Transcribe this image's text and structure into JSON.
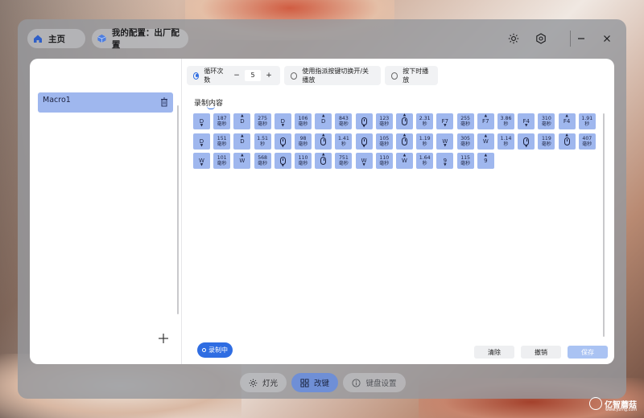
{
  "header": {
    "home_label": "主页",
    "profile_label": "我的配置：出厂配置"
  },
  "options": {
    "loop_label": "循环次数",
    "loop_minus": "−",
    "loop_value": "5",
    "loop_plus": "+",
    "toggle_label": "使用指派按键切换开/关播放",
    "hold_label": "按下时播放",
    "selected": "loop"
  },
  "sidebar": {
    "macros": [
      {
        "label": "Macro1"
      }
    ],
    "add_icon": "plus-icon"
  },
  "recording": {
    "title": "录制内容",
    "rows": [
      [
        {
          "kind": "key",
          "label": "D",
          "dir": "down"
        },
        {
          "kind": "delay",
          "value": "187",
          "unit": "毫秒"
        },
        {
          "kind": "key",
          "label": "D",
          "dir": "up"
        },
        {
          "kind": "delay",
          "value": "275",
          "unit": "毫秒"
        },
        {
          "kind": "key",
          "label": "D",
          "dir": "down"
        },
        {
          "kind": "delay",
          "value": "106",
          "unit": "毫秒"
        },
        {
          "kind": "key",
          "label": "D",
          "dir": "up"
        },
        {
          "kind": "delay",
          "value": "843",
          "unit": "毫秒"
        },
        {
          "kind": "mouse",
          "dir": "down"
        },
        {
          "kind": "delay",
          "value": "123",
          "unit": "毫秒"
        },
        {
          "kind": "mouse",
          "dir": "up"
        },
        {
          "kind": "delay",
          "value": "2.31",
          "unit": "秒"
        },
        {
          "kind": "key",
          "label": "F7",
          "dir": "down"
        },
        {
          "kind": "delay",
          "value": "255",
          "unit": "毫秒"
        },
        {
          "kind": "key",
          "label": "F7",
          "dir": "up"
        },
        {
          "kind": "delay",
          "value": "3.86",
          "unit": "秒"
        },
        {
          "kind": "key",
          "label": "F4",
          "dir": "down"
        },
        {
          "kind": "delay",
          "value": "310",
          "unit": "毫秒"
        },
        {
          "kind": "key",
          "label": "F4",
          "dir": "up"
        },
        {
          "kind": "delay",
          "value": "1.91",
          "unit": "秒"
        }
      ],
      [
        {
          "kind": "key",
          "label": "D",
          "dir": "down"
        },
        {
          "kind": "delay",
          "value": "151",
          "unit": "毫秒"
        },
        {
          "kind": "key",
          "label": "D",
          "dir": "up"
        },
        {
          "kind": "delay",
          "value": "1.51",
          "unit": "秒"
        },
        {
          "kind": "mouse",
          "dir": "down"
        },
        {
          "kind": "delay",
          "value": "98",
          "unit": "毫秒"
        },
        {
          "kind": "mouse",
          "dir": "up"
        },
        {
          "kind": "delay",
          "value": "1.41",
          "unit": "秒"
        },
        {
          "kind": "mouse",
          "dir": "down"
        },
        {
          "kind": "delay",
          "value": "105",
          "unit": "毫秒"
        },
        {
          "kind": "mouse",
          "dir": "up"
        },
        {
          "kind": "delay",
          "value": "1.19",
          "unit": "秒"
        },
        {
          "kind": "key",
          "label": "W",
          "dir": "down"
        },
        {
          "kind": "delay",
          "value": "305",
          "unit": "毫秒"
        },
        {
          "kind": "key",
          "label": "W",
          "dir": "up"
        },
        {
          "kind": "delay",
          "value": "1.14",
          "unit": "秒"
        },
        {
          "kind": "mouse",
          "dir": "down"
        },
        {
          "kind": "delay",
          "value": "119",
          "unit": "毫秒"
        },
        {
          "kind": "mouse",
          "dir": "up"
        },
        {
          "kind": "delay",
          "value": "407",
          "unit": "毫秒"
        }
      ],
      [
        {
          "kind": "key",
          "label": "W",
          "dir": "down"
        },
        {
          "kind": "delay",
          "value": "101",
          "unit": "毫秒"
        },
        {
          "kind": "key",
          "label": "W",
          "dir": "up"
        },
        {
          "kind": "delay",
          "value": "568",
          "unit": "毫秒"
        },
        {
          "kind": "mouse",
          "dir": "down"
        },
        {
          "kind": "delay",
          "value": "110",
          "unit": "毫秒"
        },
        {
          "kind": "mouse",
          "dir": "up"
        },
        {
          "kind": "delay",
          "value": "751",
          "unit": "毫秒"
        },
        {
          "kind": "key",
          "label": "W",
          "dir": "down"
        },
        {
          "kind": "delay",
          "value": "110",
          "unit": "毫秒"
        },
        {
          "kind": "key",
          "label": "W",
          "dir": "up"
        },
        {
          "kind": "delay",
          "value": "1.64",
          "unit": "秒"
        },
        {
          "kind": "key",
          "label": "9",
          "dir": "down"
        },
        {
          "kind": "delay",
          "value": "115",
          "unit": "毫秒"
        },
        {
          "kind": "key",
          "label": "9",
          "dir": "up"
        }
      ]
    ]
  },
  "actions": {
    "recording_label": "录制中",
    "clear_label": "清除",
    "undo_label": "撤销",
    "save_label": "保存"
  },
  "tabs": {
    "light_label": "灯光",
    "remap_label": "改键",
    "kbset_label": "键盘设置",
    "active": "remap"
  },
  "watermark": {
    "text": "亿智蘑菇",
    "sub": "www.yzmg.com"
  },
  "colors": {
    "accent": "#2f6de2",
    "chip": "#9fb7ee",
    "active_tab": "#6f8fd6"
  }
}
